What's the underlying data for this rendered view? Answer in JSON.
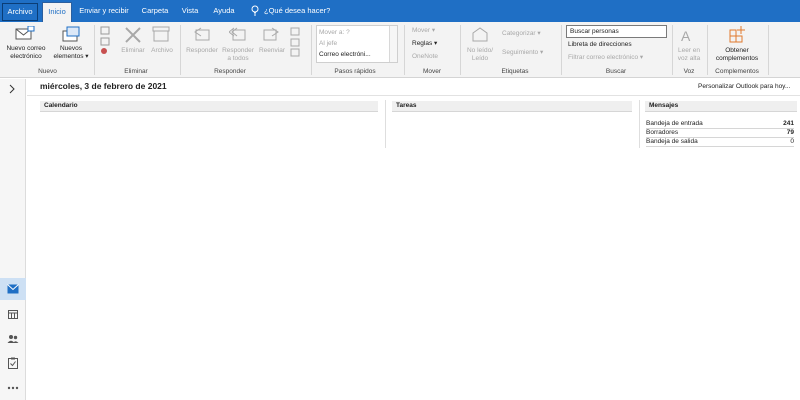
{
  "menu": {
    "file": "Archivo",
    "tabs": [
      "Inicio",
      "Enviar y recibir",
      "Carpeta",
      "Vista",
      "Ayuda"
    ],
    "tell_me": "¿Qué desea hacer?"
  },
  "ribbon": {
    "nuevo": {
      "new_email": [
        "Nuevo correo",
        "electrónico"
      ],
      "new_items": [
        "Nuevos",
        "elementos ▾"
      ],
      "label": "Nuevo"
    },
    "eliminar": {
      "delete": "Eliminar",
      "archive": "Archivo",
      "label": "Eliminar"
    },
    "responder": {
      "reply": "Responder",
      "reply_all": [
        "Responder",
        "a todos"
      ],
      "forward": "Reenviar",
      "label": "Responder"
    },
    "pasos_rapidos": {
      "items": [
        "Mover a: ?",
        "Al jefe",
        "Correo electróni..."
      ],
      "label": "Pasos rápidos"
    },
    "mover": {
      "move": "Mover ▾",
      "rules": "Reglas ▾",
      "onenote": "OneNote",
      "label": "Mover"
    },
    "etiquetas": {
      "unread": [
        "No leído/",
        "Leído"
      ],
      "categorize": "Categorizar ▾",
      "followup": "Seguimiento ▾",
      "label": "Etiquetas"
    },
    "buscar": {
      "search_people": "Buscar personas",
      "address_book": "Libreta de direcciones",
      "filter_email": "Filtrar correo electrónico ▾",
      "label": "Buscar"
    },
    "voz": {
      "read_aloud": [
        "Leer en",
        "voz alta"
      ],
      "label": "Voz"
    },
    "complementos": {
      "get_addins": [
        "Obtener",
        "complementos"
      ],
      "label": "Complementos"
    }
  },
  "main": {
    "date": "miércoles, 3 de febrero de 2021",
    "personalize": "Personalizar Outlook para hoy...",
    "calendar_title": "Calendario",
    "tasks_title": "Tareas",
    "messages_title": "Mensajes",
    "messages": [
      {
        "label": "Bandeja de entrada",
        "count": "241"
      },
      {
        "label": "Borradores",
        "count": "79"
      },
      {
        "label": "Bandeja de salida",
        "count": "0"
      }
    ]
  },
  "colors": {
    "accent": "#1f6fc5",
    "nav_active": "#cde0f4"
  }
}
